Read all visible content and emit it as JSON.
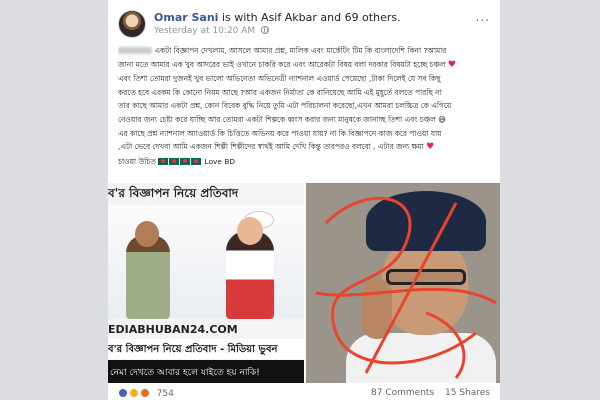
{
  "post": {
    "author": "Omar Sani",
    "tagged_text": "is with Asif Akbar and 69 others.",
    "timestamp": "Yesterday at 10:20 AM",
    "privacy_icon": "globe-icon",
    "menu_label": "..."
  },
  "text_lines": [
    "একটা বিজ্ঞাপন দেখলাম, আসলে আমার প্রশ্ন, মালিক এবং মার্কেটিং টিম কি বাংলাদেশি কিনা ?আমার",
    "জানা মতে আমার এক খুব আদরের ভাই ওখানে চাকরি করে এবং আরেকটা বিষয় বলা দরকার বিষয়টা হচ্ছে চঞ্চল",
    "এবং তিশা তোমরা দুজনই খুব ভালো অভিনেতা অভিনেত্রী ন্যাশনাল এওয়ার্ড পেয়েছো ,টাকা দিলেই যে সব কিছু",
    "করতে হবে এরকম কি কোনো নিয়ম আছে ?আর একজন নির্মাতা কে বানিয়েছে আমি এই মুহূর্তে বলতে পারছি না",
    "তার কাছে আমার একটা প্রশ্ন, কোন বিবেক বুদ্ধি নিয়ে তুমি এটা পরিচালনা করেছো,এখন আমরা চলচ্চিত্র কে এগিয়ে",
    "নেওয়ার জন্য চেষ্টা করে যাচ্ছি আর তোমরা একটা শিল্পকে ধ্বংস করার জন্য মানুষকে জানাচ্ছ তিশা এবং চঞ্চল",
    "এর কাছে প্রশ্ন ন্যাশনাল অ্যাওয়ার্ড কি চিত্তিতে অভিনয় করে পাওয়া যায়? না কি বিজ্ঞাপনে কাজ করে পাওয়া যায়",
    ",এটা ভেবে দেখবা আমি একজন শিল্পী শিল্পীদের স্বার্থই আমি দেখি কিন্তু তারপরও বলবো , এটার জন্য ক্ষমা",
    "চাওয়া উচিত"
  ],
  "inline_icons": {
    "heart": "♥",
    "smile": "😅",
    "love_bd": "Love BD"
  },
  "images": {
    "left": {
      "headline": "ব'র বিজ্ঞাপন নিয়ে প্রতিবাদ",
      "domain": "EDIABHUBAN24.COM",
      "caption": "ব'র বিজ্ঞাপন নিয়ে প্রতিবাদ - মিডিয়া ভুবন",
      "subcaption": "নেমা দেখতে আবার হলে যাইতে হয় নাকি!"
    }
  },
  "footer": {
    "reaction_icons": [
      "like-icon",
      "sad-icon",
      "angry-icon"
    ],
    "reaction_count": "754",
    "comments": "87 Comments",
    "shares": "15 Shares"
  }
}
